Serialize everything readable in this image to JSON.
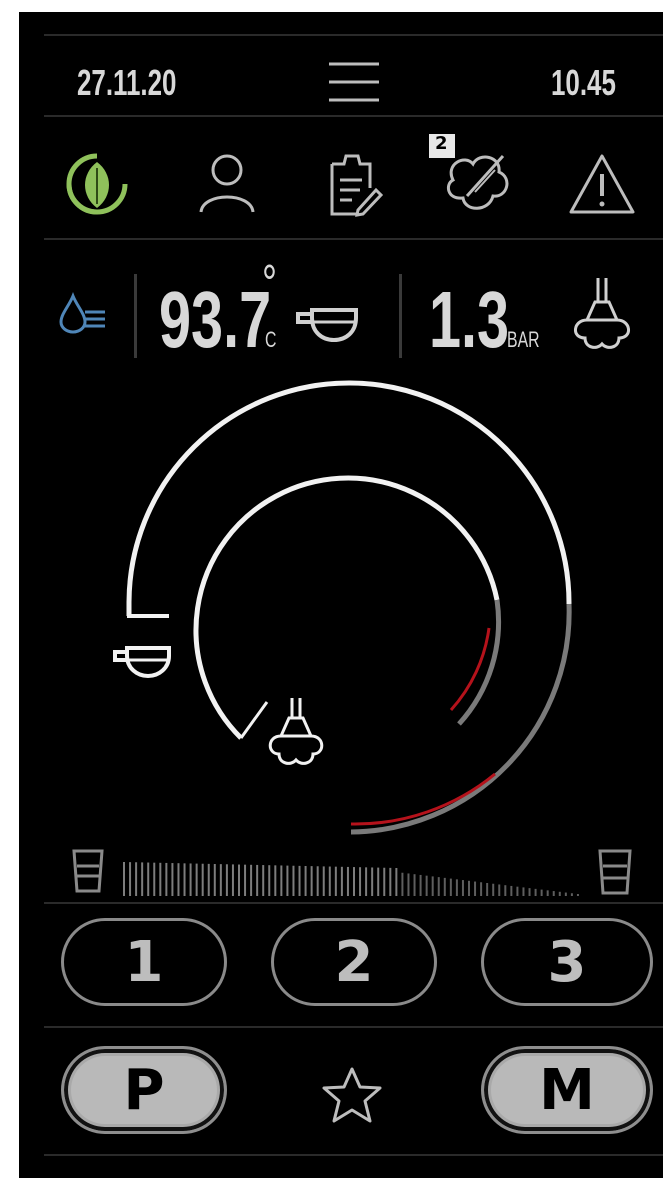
{
  "header": {
    "date": "27.11.20",
    "time": "10.45",
    "menu_icon": "hamburger-menu-icon"
  },
  "toolbar": {
    "icons": [
      "eco-mode-icon",
      "user-icon",
      "clipboard-edit-icon",
      "cleaning-icon",
      "warning-icon"
    ],
    "cleaning_badge": "2",
    "colors": {
      "eco_green": "#8fc15b",
      "water_blue": "#4f86b8"
    }
  },
  "status": {
    "temperature_value": "93.7",
    "temperature_degree": "°",
    "temperature_unit": "C",
    "pressure_value": "1.3",
    "pressure_unit": "BAR"
  },
  "gauge": {
    "outer_progress": 0.72,
    "inner_progress": 0.78,
    "accent_red": "#b5121b"
  },
  "volume_bar": {
    "level": 0.6
  },
  "presets": [
    "1",
    "2",
    "3"
  ],
  "bottom": {
    "program_label": "P",
    "manual_label": "M",
    "favorite_icon": "star-icon"
  }
}
